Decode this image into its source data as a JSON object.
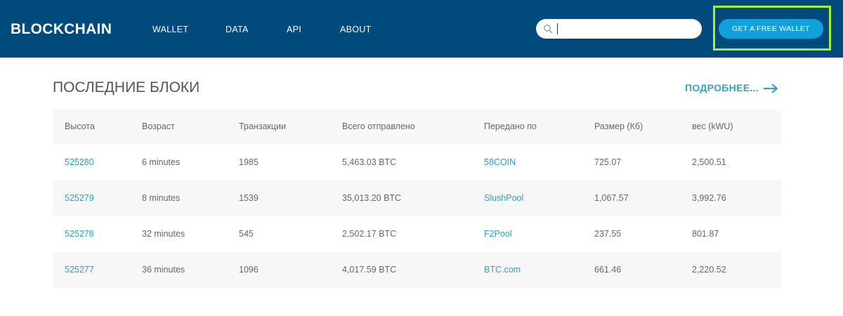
{
  "header": {
    "logo": "BLOCKCHAIN",
    "nav": [
      "WALLET",
      "DATA",
      "API",
      "ABOUT"
    ],
    "search": {
      "value": "",
      "placeholder": ""
    },
    "cta": "GET A FREE WALLET"
  },
  "section": {
    "title": "ПОСЛЕДНИЕ БЛОКИ",
    "more": "ПОДРОБНЕЕ..."
  },
  "table": {
    "columns": [
      "Высота",
      "Возраст",
      "Транзакции",
      "Всего отправлено",
      "Передано по",
      "Размер (Кб)",
      "вес (kWU)"
    ],
    "rows": [
      [
        "525280",
        "6 minutes",
        "1985",
        "5,463.03 BTC",
        "58COIN",
        "725.07",
        "2,500.51"
      ],
      [
        "525279",
        "8 minutes",
        "1539",
        "35,013.20 BTC",
        "SlushPool",
        "1,067.57",
        "3,992.76"
      ],
      [
        "525278",
        "32 minutes",
        "545",
        "2,502.17 BTC",
        "F2Pool",
        "237.55",
        "801.87"
      ],
      [
        "525277",
        "36 minutes",
        "1096",
        "4,017.59 BTC",
        "BTC.com",
        "661.46",
        "2,220.52"
      ]
    ]
  },
  "colors": {
    "header": "#004a7c",
    "button": "#10a0dc",
    "link": "#2ca0bf",
    "highlight": "#a8f02a"
  }
}
